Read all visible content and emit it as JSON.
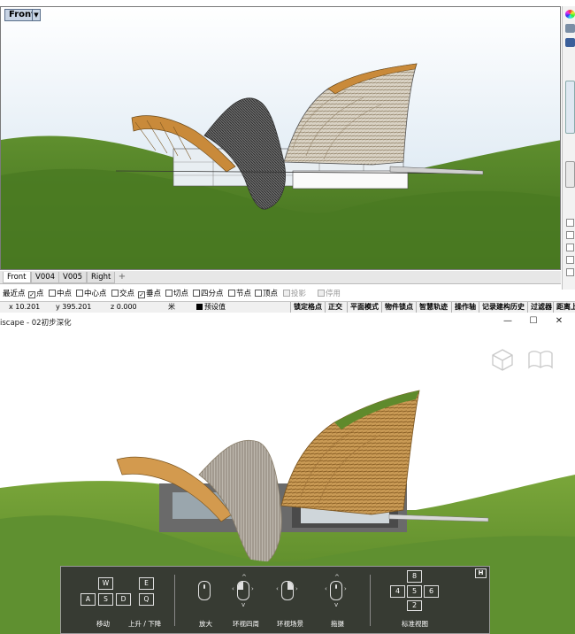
{
  "rhino": {
    "viewport_title": "Front",
    "viewport_tabs": [
      "Front",
      "V004",
      "V005",
      "Right"
    ],
    "add_tab_symbol": "+",
    "osnap": {
      "label": "最近点",
      "items": [
        {
          "label": "点",
          "checked": true
        },
        {
          "label": "中点",
          "checked": false
        },
        {
          "label": "中心点",
          "checked": false
        },
        {
          "label": "交点",
          "checked": false
        },
        {
          "label": "垂点",
          "checked": true
        },
        {
          "label": "切点",
          "checked": false
        },
        {
          "label": "四分点",
          "checked": false
        },
        {
          "label": "节点",
          "checked": false
        },
        {
          "label": "顶点",
          "checked": false
        },
        {
          "label": "投影",
          "checked": false,
          "disabled": true
        },
        {
          "label": "停用",
          "checked": false,
          "disabled": true
        }
      ]
    },
    "status": {
      "x": "x 10.201",
      "y": "y 395.201",
      "z": "z 0.000",
      "unit": "米",
      "layer": "预设值",
      "panes": [
        "锁定格点",
        "正交",
        "平面模式",
        "物件锁点",
        "智慧轨迹",
        "操作轴",
        "记录建构历史",
        "过滤器",
        "距离上"
      ]
    },
    "colors": {
      "sky_top": "#ffffff",
      "sky_bottom": "#cfe0ee",
      "grass": "#4f7f24",
      "wood": "#c98a3a"
    }
  },
  "enscape": {
    "title": "iscape - 02初步深化",
    "window_buttons": {
      "minimize": "—",
      "maximize": "☐",
      "close": "✕"
    },
    "corner_icons": [
      "cube-view-icon",
      "book-icon"
    ],
    "nav_panel": {
      "hide_key": "H",
      "keys": {
        "w": "W",
        "a": "A",
        "s": "S",
        "d": "D",
        "e": "E",
        "q": "Q"
      },
      "labels": {
        "move": "移动",
        "up_down": "上升 / 下降",
        "zoom": "放大",
        "orbit": "环视四周",
        "look_around": "环视场景",
        "pan": "拖摄",
        "standard_views": "标准视图"
      },
      "numpad": {
        "n8": "8",
        "n4": "4",
        "n5": "5",
        "n6": "6",
        "n2": "2"
      }
    }
  }
}
